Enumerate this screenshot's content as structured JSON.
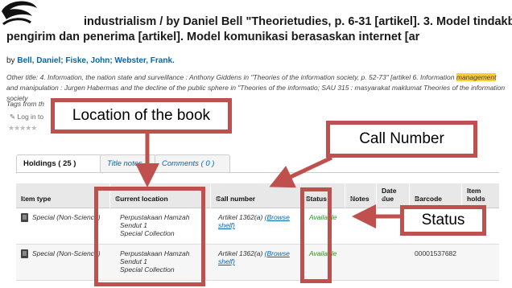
{
  "record": {
    "title_line1": "industrialism / by Daniel Bell \"Theorietudies, p. 6-31 [artikel]. 3. Model tindakbalas antar",
    "title_line2": "pengirim dan penerima [artikel]. Model komunikasi berasaskan internet [ar",
    "by": "by",
    "authors": [
      "Bell, Daniel;",
      "Fiske, John;",
      "Webster, Frank."
    ],
    "other_title_label": "Other title:",
    "other_title_pre": "4. Information, the nation state and surveillance : Anthony Giddens in \"Theories of the information society, p. 52-73\" [artikel 6. Information ",
    "other_title_hl": "management",
    "other_title_post": " and manipulation : Jurgen Habermas and the decline of the public sphere in \"Theories of the informatio; SAU 315 : masyarakat maklumat Theories of the information society",
    "tags": "Tags from th",
    "login": "Log in to",
    "stars": "★★★★★"
  },
  "tabs": [
    {
      "label": "Holdings ( 25 )",
      "active": true
    },
    {
      "label": "Title notes",
      "active": false
    },
    {
      "label": "Comments ( 0 )",
      "active": false
    }
  ],
  "table": {
    "headers": [
      "Item type",
      "Current location",
      "Call number",
      "Status",
      "Notes",
      "Date due",
      "Barcode",
      "Item holds"
    ],
    "rows": [
      {
        "item_type": "Special (Non-Science)",
        "location": [
          "Perpustakaan Hamzah",
          "Sendut 1",
          "Special Collection"
        ],
        "call_number": "Artikel 1362(a)",
        "browse": "(Browse shelf)",
        "status": "Available",
        "barcode": ""
      },
      {
        "item_type": "Special (Non-Science)",
        "location": [
          "Perpustakaan Hamzah",
          "Sendut 1",
          "Special Collection"
        ],
        "call_number": "Artikel 1362(a)",
        "browse": "(Browse shelf)",
        "status": "Available",
        "barcode": "00001537682"
      }
    ]
  },
  "annotations": {
    "location": "Location of the book",
    "call_number": "Call Number",
    "status": "Status",
    "color": "#c0504d"
  }
}
